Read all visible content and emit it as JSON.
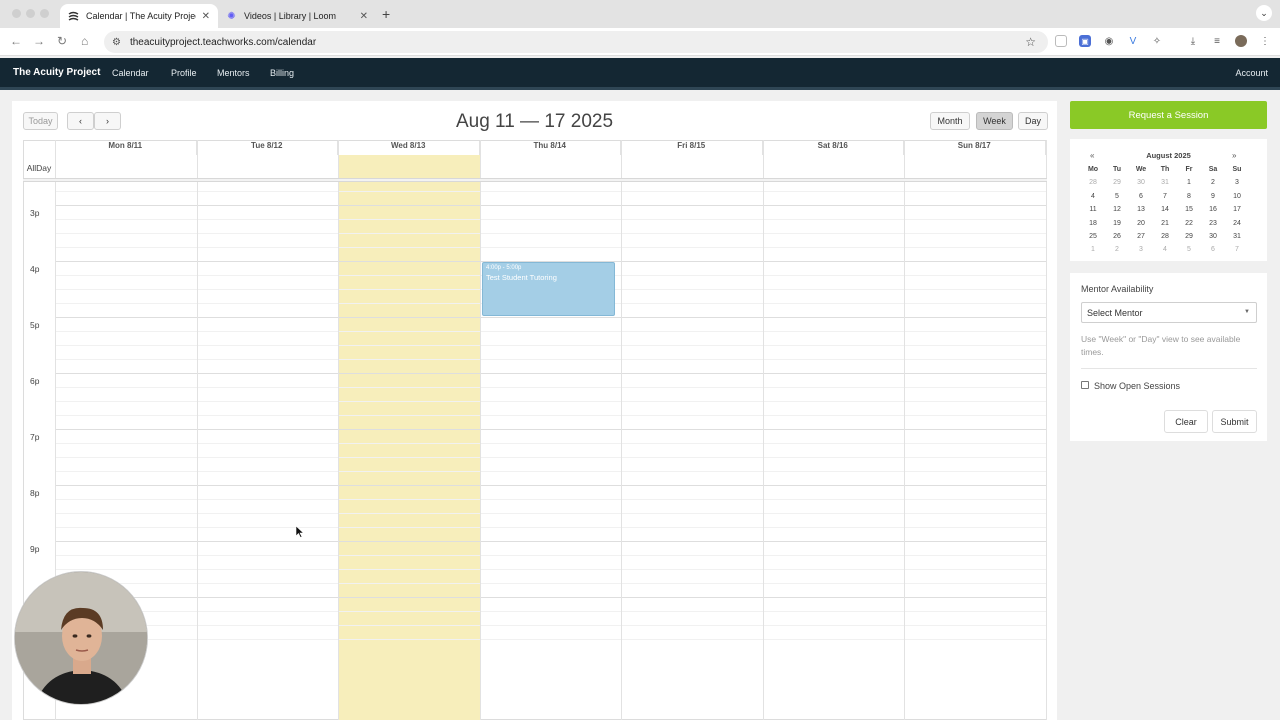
{
  "browser": {
    "tabs": [
      {
        "title": "Calendar | The Acuity Project",
        "active": true,
        "icon": "acuity-favicon-icon"
      },
      {
        "title": "Videos | Library | Loom",
        "active": false,
        "icon": "loom-favicon-icon"
      }
    ],
    "url": "theacuityproject.teachworks.com/calendar"
  },
  "nav": {
    "brand": "The Acuity Project",
    "links": [
      "Calendar",
      "Profile",
      "Mentors",
      "Billing"
    ],
    "account": "Account"
  },
  "calendar": {
    "today_label": "Today",
    "title": "Aug 11 — 17 2025",
    "views": [
      "Month",
      "Week",
      "Day"
    ],
    "active_view": "Week",
    "allday_label": "AllDay",
    "days": [
      "Mon 8/11",
      "Tue 8/12",
      "Wed 8/13",
      "Thu 8/14",
      "Fri 8/15",
      "Sat 8/16",
      "Sun 8/17"
    ],
    "today_index": 2,
    "hours": [
      "3p",
      "4p",
      "5p",
      "6p",
      "7p",
      "8p",
      "9p"
    ],
    "events": [
      {
        "time": "4:00p - 5:00p",
        "title": "Test Student Tutoring",
        "day": "Thu 8/14",
        "color": "#a4cee6"
      }
    ]
  },
  "sidebar": {
    "request_button": "Request a Session",
    "minical": {
      "prev": "«",
      "next": "»",
      "month": "August 2025",
      "weekdays": [
        "Mo",
        "Tu",
        "We",
        "Th",
        "Fr",
        "Sa",
        "Su"
      ],
      "weeks": [
        [
          "28",
          "29",
          "30",
          "31",
          "1",
          "2",
          "3"
        ],
        [
          "4",
          "5",
          "6",
          "7",
          "8",
          "9",
          "10"
        ],
        [
          "11",
          "12",
          "13",
          "14",
          "15",
          "16",
          "17"
        ],
        [
          "18",
          "19",
          "20",
          "21",
          "22",
          "23",
          "24"
        ],
        [
          "25",
          "26",
          "27",
          "28",
          "29",
          "30",
          "31"
        ],
        [
          "1",
          "2",
          "3",
          "4",
          "5",
          "6",
          "7"
        ]
      ]
    },
    "availability": {
      "title": "Mentor Availability",
      "select_value": "Select Mentor",
      "hint": "Use \"Week\" or \"Day\" view to see available times.",
      "checkbox_label": "Show Open Sessions",
      "clear": "Clear",
      "submit": "Submit"
    }
  },
  "colors": {
    "accent_green": "#8ac926",
    "nav_bg": "#142733",
    "today_highlight": "#f7eebb",
    "event_blue": "#a4cee6"
  }
}
